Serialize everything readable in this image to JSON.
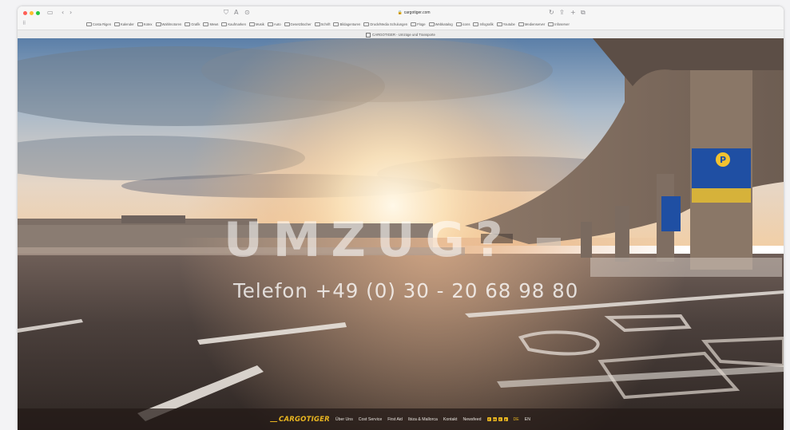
{
  "browser": {
    "url": "cargotiger.com",
    "tab_title": "CARGOTIGER - Umzüge und Transporte",
    "bookmarks": [
      "Costa Rigen",
      "Kalender",
      "Kotex",
      "Wahlmotoren",
      "Grafik",
      "Mews",
      "Kaufmarken",
      "Musik",
      "Auto",
      "Gesetzbücher",
      "Schrift",
      "Bildagenturen",
      "Druck/Media Schulungen",
      "Flüge",
      "Webkatalog",
      "icons",
      "Infografik",
      "Youtube",
      "Medienserver",
      "Infoserver"
    ]
  },
  "hero": {
    "title": "UMZUG?",
    "phone": "Telefon +49 (0) 30 - 20 68 98 80"
  },
  "parking_sign": "P",
  "footer": {
    "logo": "CARGOTIGER",
    "nav": [
      "Über Uns",
      "Cost Service",
      "First Aid",
      "Ibiza & Mallorca",
      "Kontakt",
      "Newsfeed"
    ],
    "social": [
      "f",
      "in",
      "t",
      "y"
    ],
    "lang": [
      "DE",
      "EN"
    ]
  },
  "colors": {
    "accent": "#e8b520",
    "footer_bg": "#231916",
    "sign_blue": "#1f4fa3"
  }
}
